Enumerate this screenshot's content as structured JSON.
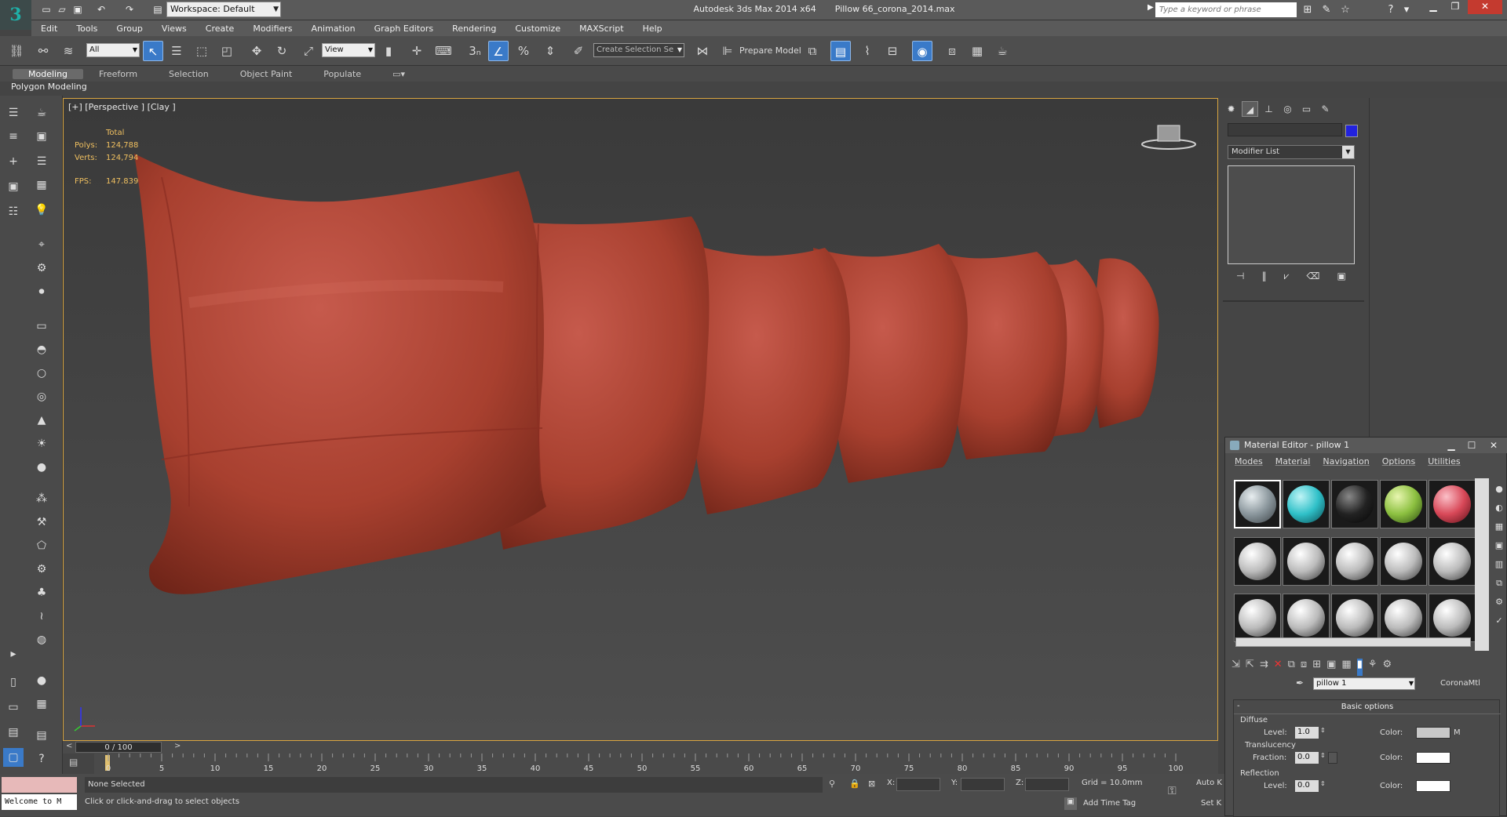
{
  "titlebar": {
    "workspace": "Workspace: Default",
    "app_name": "Autodesk 3ds Max  2014 x64",
    "file_name": "Pillow 66_corona_2014.max",
    "search_placeholder": "Type a keyword or phrase"
  },
  "menu": [
    "Edit",
    "Tools",
    "Group",
    "Views",
    "Create",
    "Modifiers",
    "Animation",
    "Graph Editors",
    "Rendering",
    "Customize",
    "MAXScript",
    "Help"
  ],
  "toolbar": {
    "filter": "All",
    "refcoord": "View",
    "selection_set": "Create Selection Se",
    "prepare_model": "Prepare Model"
  },
  "ribbon": {
    "tabs": [
      "Modeling",
      "Freeform",
      "Selection",
      "Object Paint",
      "Populate"
    ],
    "active_tab": "Modeling",
    "panel_label": "Polygon Modeling"
  },
  "viewport": {
    "label": "[+] [Perspective ] [Clay ]",
    "stats": {
      "total_label": "Total",
      "polys_label": "Polys:",
      "polys": "124,788",
      "verts_label": "Verts:",
      "verts": "124,794",
      "fps_label": "FPS:",
      "fps": "147.839"
    },
    "object_color": "#b5473b"
  },
  "command_panel": {
    "modifier_list": "Modifier List",
    "object_color": "#2222dd"
  },
  "material_editor": {
    "title": "Material Editor - pillow 1",
    "menu": [
      "Modes",
      "Material",
      "Navigation",
      "Options",
      "Utilities"
    ],
    "material_name": "pillow 1",
    "material_type": "CoronaMtl",
    "rollout_title": "Basic options",
    "diffuse_label": "Diffuse",
    "level_label": "Level:",
    "diffuse_level": "1.0",
    "color_label": "Color:",
    "m_label": "M",
    "translucency_label": "Translucency",
    "fraction_label": "Fraction:",
    "fraction_value": "0.0",
    "reflection_label": "Reflection",
    "reflection_level": "0.0",
    "slot_colors": [
      "#9aa4aa",
      "#2fc0c8",
      "#222222",
      "#8cc040",
      "#d84858"
    ]
  },
  "timeline": {
    "frame": "0 / 100",
    "ticks": [
      "0",
      "5",
      "10",
      "15",
      "20",
      "25",
      "30",
      "35",
      "40",
      "45",
      "50",
      "55",
      "60",
      "65",
      "70",
      "75",
      "80",
      "85",
      "90",
      "95",
      "100"
    ]
  },
  "status": {
    "maxscript": "Welcome to M",
    "selection": "None Selected",
    "prompt": "Click or click-and-drag to select objects",
    "x_label": "X:",
    "y_label": "Y:",
    "z_label": "Z:",
    "grid": "Grid = 10.0mm",
    "add_time_tag": "Add Time Tag",
    "auto_key": "Auto K",
    "set_key": "Set K"
  }
}
